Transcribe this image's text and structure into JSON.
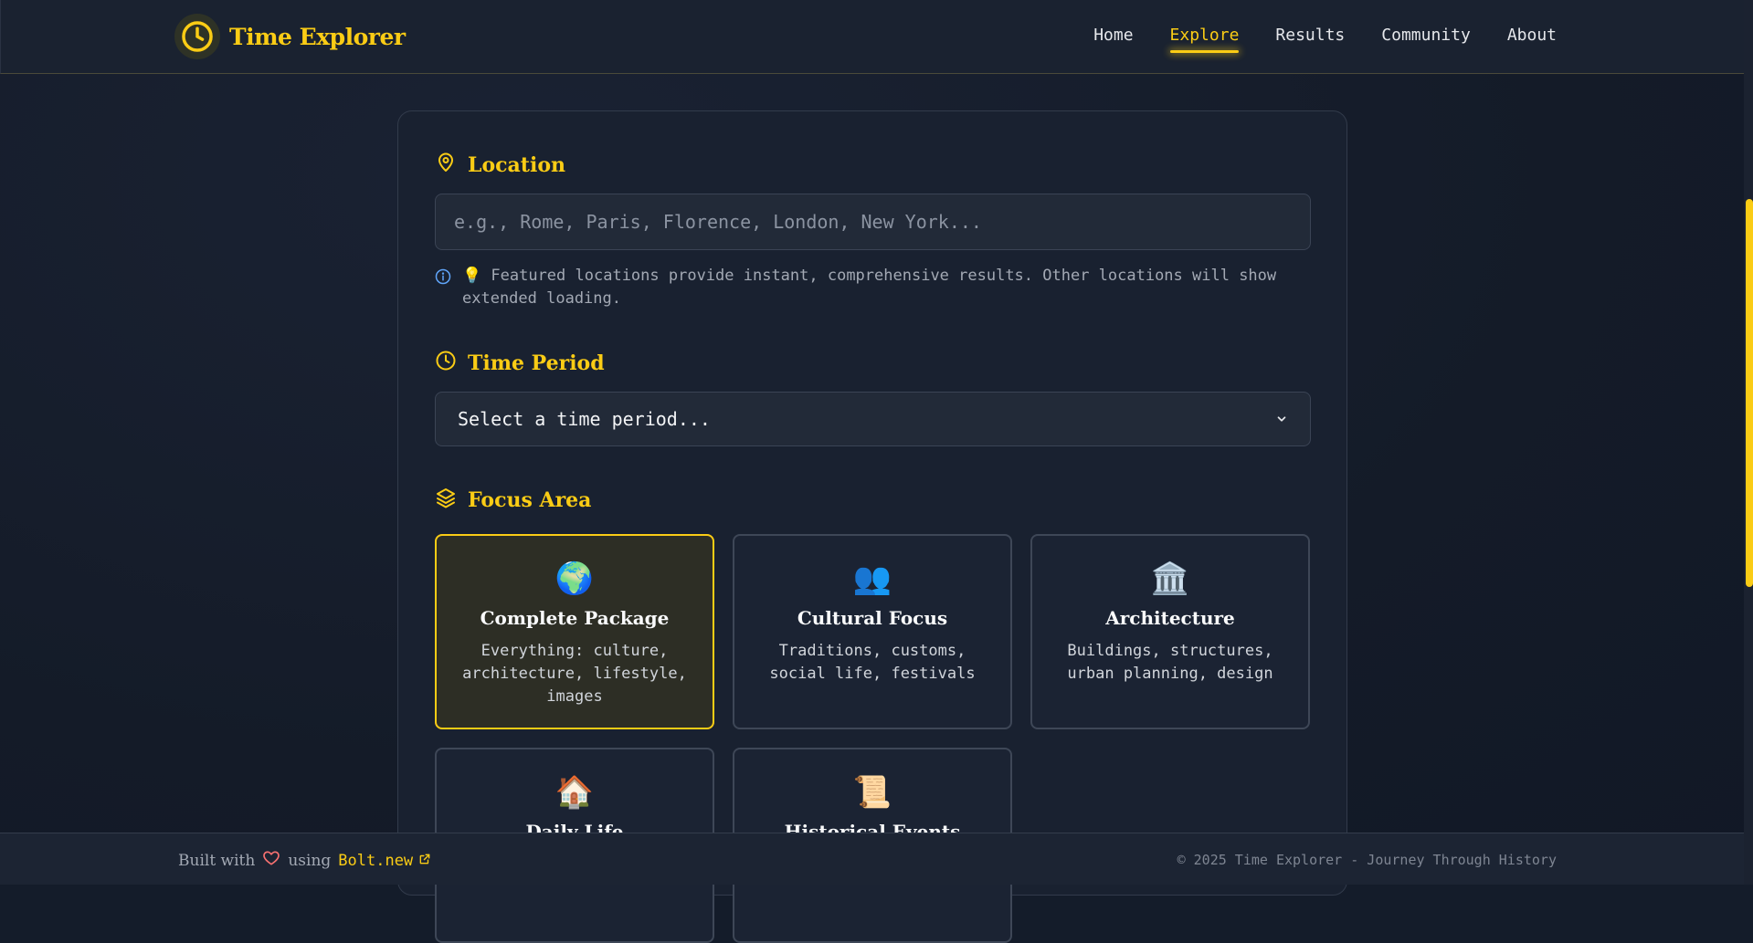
{
  "header": {
    "brand": "Time Explorer",
    "nav": [
      {
        "label": "Home",
        "active": false
      },
      {
        "label": "Explore",
        "active": true
      },
      {
        "label": "Results",
        "active": false
      },
      {
        "label": "Community",
        "active": false
      },
      {
        "label": "About",
        "active": false
      }
    ]
  },
  "form": {
    "location": {
      "title": "Location",
      "placeholder": "e.g., Rome, Paris, Florence, London, New York...",
      "value": "",
      "hint": "💡 Featured locations provide instant, comprehensive results. Other locations will show extended loading."
    },
    "time_period": {
      "title": "Time Period",
      "selected": "Select a time period..."
    },
    "focus_area": {
      "title": "Focus Area",
      "options": [
        {
          "emoji": "🌍",
          "title": "Complete Package",
          "desc": "Everything: culture, architecture, lifestyle, images",
          "selected": true
        },
        {
          "emoji": "👥",
          "title": "Cultural Focus",
          "desc": "Traditions, customs, social life, festivals",
          "selected": false
        },
        {
          "emoji": "🏛️",
          "title": "Architecture",
          "desc": "Buildings, structures, urban planning, design",
          "selected": false
        },
        {
          "emoji": "🏠",
          "title": "Daily Life",
          "desc": "",
          "selected": false
        },
        {
          "emoji": "📜",
          "title": "Historical Events",
          "desc": "",
          "selected": false
        }
      ]
    }
  },
  "footer": {
    "built_with": "Built with",
    "using": "using",
    "link": "Bolt.new",
    "copyright": "© 2025 Time Explorer - Journey Through History"
  },
  "colors": {
    "accent": "#facc15",
    "background": "#141c2a",
    "card": "#192130"
  }
}
